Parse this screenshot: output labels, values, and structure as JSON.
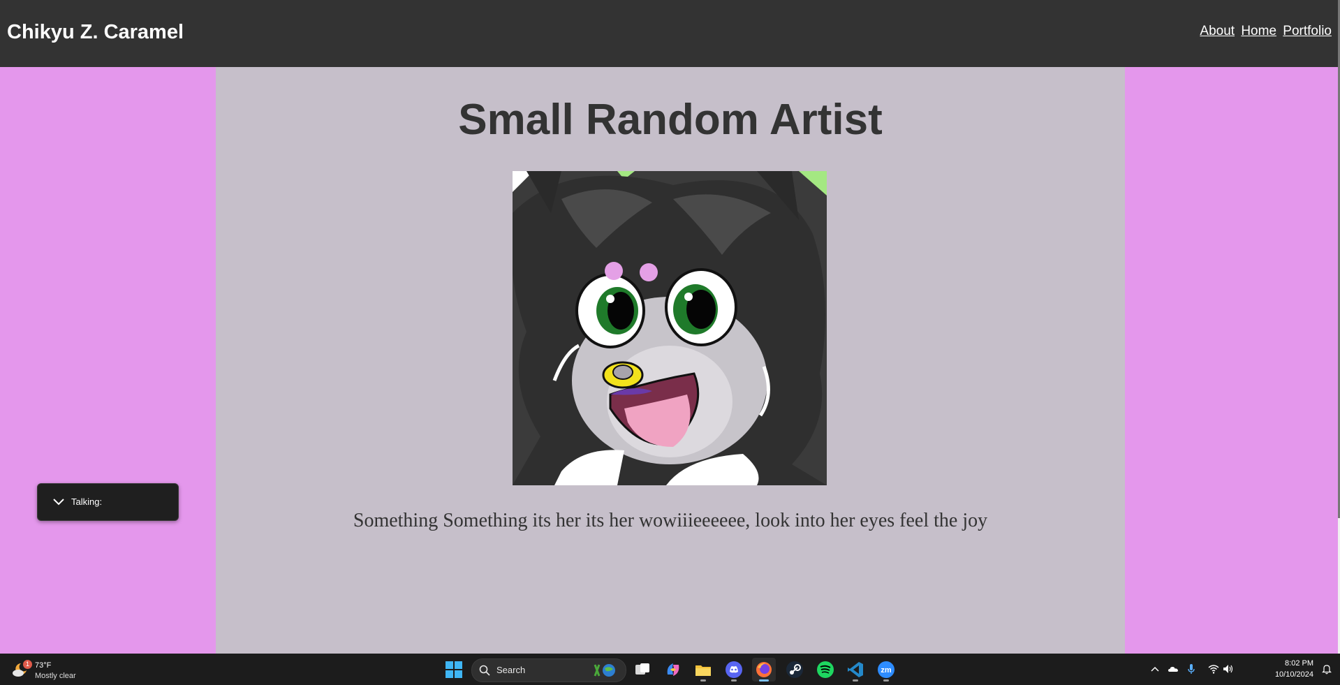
{
  "header": {
    "site_title": "Chikyu Z. Caramel",
    "nav": [
      {
        "label": "About"
      },
      {
        "label": "Home"
      },
      {
        "label": "Portfolio"
      }
    ]
  },
  "main": {
    "heading": "Small Random Artist",
    "caption": "Something Something its her its her wowiiieeeeee, look into her eyes feel the joy"
  },
  "talking_overlay": {
    "label": "Talking:"
  },
  "taskbar": {
    "weather": {
      "temperature": "73°F",
      "condition": "Mostly clear",
      "badge": "1"
    },
    "search_label": "Search",
    "pinned_apps": [
      "windows-start",
      "task-view",
      "copilot",
      "file-explorer",
      "discord",
      "firefox",
      "steam",
      "spotify",
      "vs-code",
      "zoom"
    ],
    "active_app": "firefox",
    "clock": {
      "time": "8:02 PM",
      "date": "10/10/2024"
    }
  },
  "colors": {
    "page_background": "#e497ec",
    "header_background": "#333333",
    "content_background": "#c6bfca",
    "text": "#333333"
  }
}
